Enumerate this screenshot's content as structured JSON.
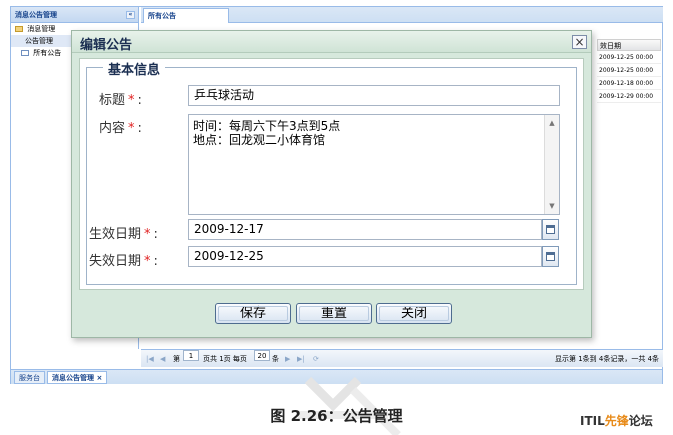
{
  "app": {
    "left_panel": {
      "title": "消息公告管理",
      "collapse_glyph": "«",
      "tree": [
        {
          "label": "消息管理",
          "icon": "folder-icon"
        },
        {
          "label": "公告管理",
          "icon": null
        },
        {
          "label": "所有公告",
          "icon": "page-icon"
        }
      ]
    },
    "main": {
      "tab": "所有公告",
      "grid": {
        "column": "效日期",
        "rows": [
          "2009-12-25 00:00",
          "2009-12-25 00:00",
          "2009-12-18 00:00",
          "2009-12-29 00:00"
        ]
      },
      "pager": {
        "page_label": "第",
        "page_value": "1",
        "total_label": "页共 1页 每页",
        "per_page": "20",
        "per_page_unit": "条",
        "summary": "显示第 1条到 4条记录，一共 4条"
      }
    },
    "bottom_tabs": [
      {
        "label": "服务台",
        "active": false
      },
      {
        "label": "消息公告管理",
        "active": true,
        "close": "×"
      }
    ]
  },
  "dialog": {
    "title": "编辑公告",
    "close_glyph": "×",
    "fieldset_legend": "基本信息",
    "required_mark": "*",
    "colon": ":",
    "fields": {
      "title": {
        "label": "标题",
        "value": "乒乓球活动"
      },
      "content": {
        "label": "内容",
        "lines": [
          "时间：每周六下午3点到5点",
          "地点：回龙观二小体育馆"
        ]
      },
      "start_date": {
        "label": "生效日期",
        "value": "2009-12-17"
      },
      "end_date": {
        "label": "失效日期",
        "value": "2009-12-25"
      }
    },
    "buttons": {
      "save": "保存",
      "reset": "重置",
      "close": "关闭"
    }
  },
  "caption": "图 2.26：公告管理",
  "brand": {
    "prefix": "ITIL",
    "highlight": "先锋",
    "suffix": "论坛"
  }
}
